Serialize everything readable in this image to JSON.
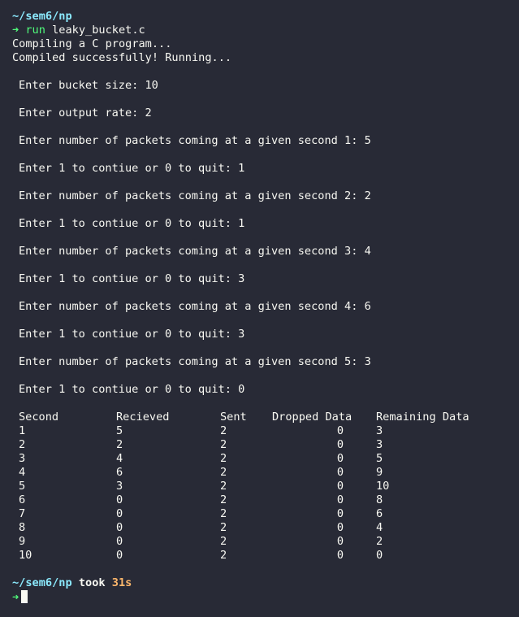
{
  "prompt": {
    "cwd": "~/sem6/np",
    "arrow": "➜",
    "command_word": "run",
    "command_arg": "leaky_bucket.c"
  },
  "output": {
    "compiling": "Compiling a C program...",
    "compiled": "Compiled successfully! Running..."
  },
  "session": [
    "Enter bucket size: 10",
    "Enter output rate: 2",
    "Enter number of packets coming at a given second 1: 5",
    "Enter 1 to contiue or 0 to quit: 1",
    "Enter number of packets coming at a given second 2: 2",
    "Enter 1 to contiue or 0 to quit: 1",
    "Enter number of packets coming at a given second 3: 4",
    "Enter 1 to contiue or 0 to quit: 3",
    "Enter number of packets coming at a given second 4: 6",
    "Enter 1 to contiue or 0 to quit: 3",
    "Enter number of packets coming at a given second 5: 3",
    "Enter 1 to contiue or 0 to quit: 0"
  ],
  "table": {
    "headers": [
      "Second",
      "Recieved",
      "Sent",
      "Dropped Data",
      "Remaining Data"
    ],
    "rows": [
      [
        "1",
        "5",
        "2",
        "0",
        "3"
      ],
      [
        "2",
        "2",
        "2",
        "0",
        "3"
      ],
      [
        "3",
        "4",
        "2",
        "0",
        "5"
      ],
      [
        "4",
        "6",
        "2",
        "0",
        "9"
      ],
      [
        "5",
        "3",
        "2",
        "0",
        "10"
      ],
      [
        "6",
        "0",
        "2",
        "0",
        "8"
      ],
      [
        "7",
        "0",
        "2",
        "0",
        "6"
      ],
      [
        "8",
        "0",
        "2",
        "0",
        "4"
      ],
      [
        "9",
        "0",
        "2",
        "0",
        "2"
      ],
      [
        "10",
        "0",
        "2",
        "0",
        "0"
      ]
    ]
  },
  "footer": {
    "cwd": "~/sem6/np",
    "took_word": "took",
    "duration": "31s",
    "arrow": "➜"
  },
  "colors": {
    "background": "#282a36",
    "foreground": "#f8f8f2",
    "cwd": "#8be9fd",
    "arrow": "#50fa7b",
    "duration": "#ffb86c"
  }
}
